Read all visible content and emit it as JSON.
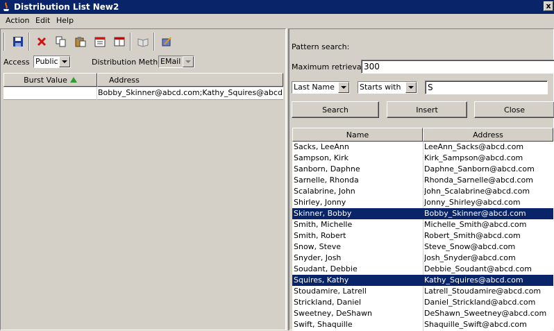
{
  "window": {
    "title": "Distribution List New2",
    "close_glyph": "x"
  },
  "menu": [
    {
      "label": "Action"
    },
    {
      "label": "Edit"
    },
    {
      "label": "Help"
    }
  ],
  "toolbar": {
    "icons": [
      "save-icon",
      "delete-icon",
      "copy-icon",
      "paste-icon",
      "calendar-icon",
      "book-icon",
      "open-book-icon",
      "edit-notebook-icon"
    ]
  },
  "access": {
    "label": "Access",
    "value": "Public"
  },
  "distribution_method": {
    "label": "Distribution Method",
    "value": "EMail"
  },
  "left_table": {
    "columns": [
      "Burst Value",
      "Address"
    ],
    "rows": [
      {
        "burst": "",
        "address": "Bobby_Skinner@abcd.com;Kathy_Squires@abcd.com"
      }
    ]
  },
  "search": {
    "pattern_label": "Pattern search:",
    "max_label": "Maximum retrieval:",
    "max_value": "300",
    "field": "Last Name",
    "operator": "Starts with",
    "text": "S"
  },
  "buttons": {
    "search": "Search",
    "insert": "Insert",
    "close": "Close"
  },
  "results": {
    "columns": [
      "Name",
      "Address"
    ],
    "rows": [
      {
        "name": "Sacks, LeeAnn",
        "address": "LeeAnn_Sacks@abcd.com",
        "selected": false
      },
      {
        "name": "Sampson, Kirk",
        "address": "Kirk_Sampson@abcd.com",
        "selected": false
      },
      {
        "name": "Sanborn, Daphne",
        "address": "Daphne_Sanborn@abcd.com",
        "selected": false
      },
      {
        "name": "Sarnelle, Rhonda",
        "address": "Rhonda_Sarnelle@abcd.com",
        "selected": false
      },
      {
        "name": "Scalabrine, John",
        "address": "John_Scalabrine@abcd.com",
        "selected": false
      },
      {
        "name": "Shirley, Jonny",
        "address": "Jonny_Shirley@abcd.com",
        "selected": false
      },
      {
        "name": "Skinner, Bobby",
        "address": "Bobby_Skinner@abcd.com",
        "selected": true
      },
      {
        "name": "Smith, Michelle",
        "address": "Michelle_Smith@abcd.com",
        "selected": false
      },
      {
        "name": "Smith, Robert",
        "address": "Robert_Smith@abcd.com",
        "selected": false
      },
      {
        "name": "Snow, Steve",
        "address": "Steve_Snow@abcd.com",
        "selected": false
      },
      {
        "name": "Snyder, Josh",
        "address": "Josh_Snyder@abcd.com",
        "selected": false
      },
      {
        "name": "Soudant, Debbie",
        "address": "Debbie_Soudant@abcd.com",
        "selected": false
      },
      {
        "name": "Squires, Kathy",
        "address": "Kathy_Squires@abcd.com",
        "selected": true
      },
      {
        "name": "Stoudamire, Latrell",
        "address": "Latrell_Stoudamire@abcd.com",
        "selected": false
      },
      {
        "name": "Strickland, Daniel",
        "address": "Daniel_Strickland@abcd.com",
        "selected": false
      },
      {
        "name": "Sweetney, DeShawn",
        "address": "DeShawn_Sweetney@abcd.com",
        "selected": false
      },
      {
        "name": "Swift, Shaquille",
        "address": "Shaquille_Swift@abcd.com",
        "selected": false
      }
    ]
  },
  "colors": {
    "title_bg": "#0a246a",
    "selection_bg": "#0a246a",
    "face": "#d4d0c8",
    "sort_arrow": "#2e9b2e"
  }
}
